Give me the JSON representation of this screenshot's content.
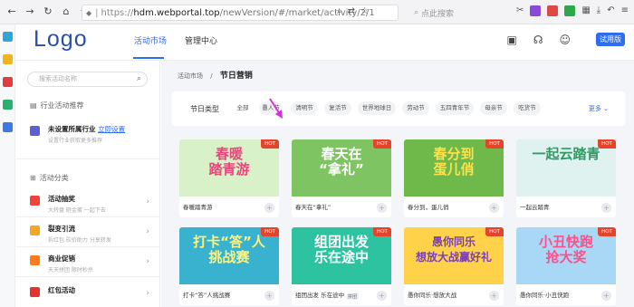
{
  "browser": {
    "url_scheme": "https://",
    "url_host": "hdm.webportal.top",
    "url_path": "/newVersion/#/market/activity/2/1",
    "search_placeholder": "点此搜索"
  },
  "topnav": {
    "logo": "Logo",
    "tabs": [
      "活动市场",
      "管理中心"
    ],
    "try_label": "试用版"
  },
  "sidebar": {
    "search_placeholder": "搜索活动名称",
    "industry_section": "行业活动推荐",
    "industry_title": "未设置所属行业",
    "industry_link": "立即设置",
    "industry_sub": "设置行业获取更多推荐",
    "category_section": "活动分类",
    "items": [
      {
        "title": "活动抽奖",
        "sub": "大转盘 砸金蛋 一起下去"
      },
      {
        "title": "裂变引流",
        "sub": "拆红包 砍价助力 分享转发"
      },
      {
        "title": "商业促销",
        "sub": "天天拼团 限时秒杀"
      },
      {
        "title": "红包活动",
        "sub": ""
      }
    ]
  },
  "main": {
    "breadcrumb_parent": "活动市场",
    "breadcrumb_sep": "/",
    "breadcrumb_current": "节日营销",
    "filter_label": "节日类型",
    "chips": [
      "全部",
      "愚人节",
      "清明节",
      "复活节",
      "世界地球日",
      "劳动节",
      "五四青年节",
      "母亲节",
      "吃货节"
    ],
    "more_label": "更多",
    "hot_label": "HOT",
    "cards": [
      {
        "caption": "春暖踏青游",
        "art": "春暖\n踏青游",
        "bg": "#d9f1c9",
        "fg": "#e6487a"
      },
      {
        "caption": "春天在“拿礼”",
        "art": "春天在\n“拿礼”",
        "bg": "#7fc463",
        "fg": "#ffffff"
      },
      {
        "caption": "春分到，蛋儿俏",
        "art": "春分到\n蛋儿俏",
        "bg": "#6fb84a",
        "fg": "#ffe14a"
      },
      {
        "caption": "一起云踏青",
        "art": "一起云踏青",
        "bg": "#dff2f0",
        "fg": "#2f9b62"
      },
      {
        "caption": "打卡“答”人挑战赛",
        "art": "打卡“答”人\n挑战赛",
        "bg": "#39b2cf",
        "fg": "#fff27a"
      },
      {
        "caption": "组团出发 乐在途中",
        "art": "组团出发\n乐在途中",
        "bg": "#2ec3a0",
        "fg": "#ffffff",
        "badge": "拼团"
      },
      {
        "caption": "愚你同乐·想放大战",
        "art": "愚你同乐\n想放大战赢好礼",
        "bg": "#ffd24a",
        "fg": "#7a3fb4"
      },
      {
        "caption": "愚你同乐·小丑快跑",
        "art": "小丑快跑\n抢大奖",
        "bg": "#a8d8f5",
        "fg": "#ff4f8b"
      }
    ]
  },
  "colors": {
    "accent": "#2f6df0",
    "hot": "#e6432a",
    "arrow": "#d62ee0"
  }
}
